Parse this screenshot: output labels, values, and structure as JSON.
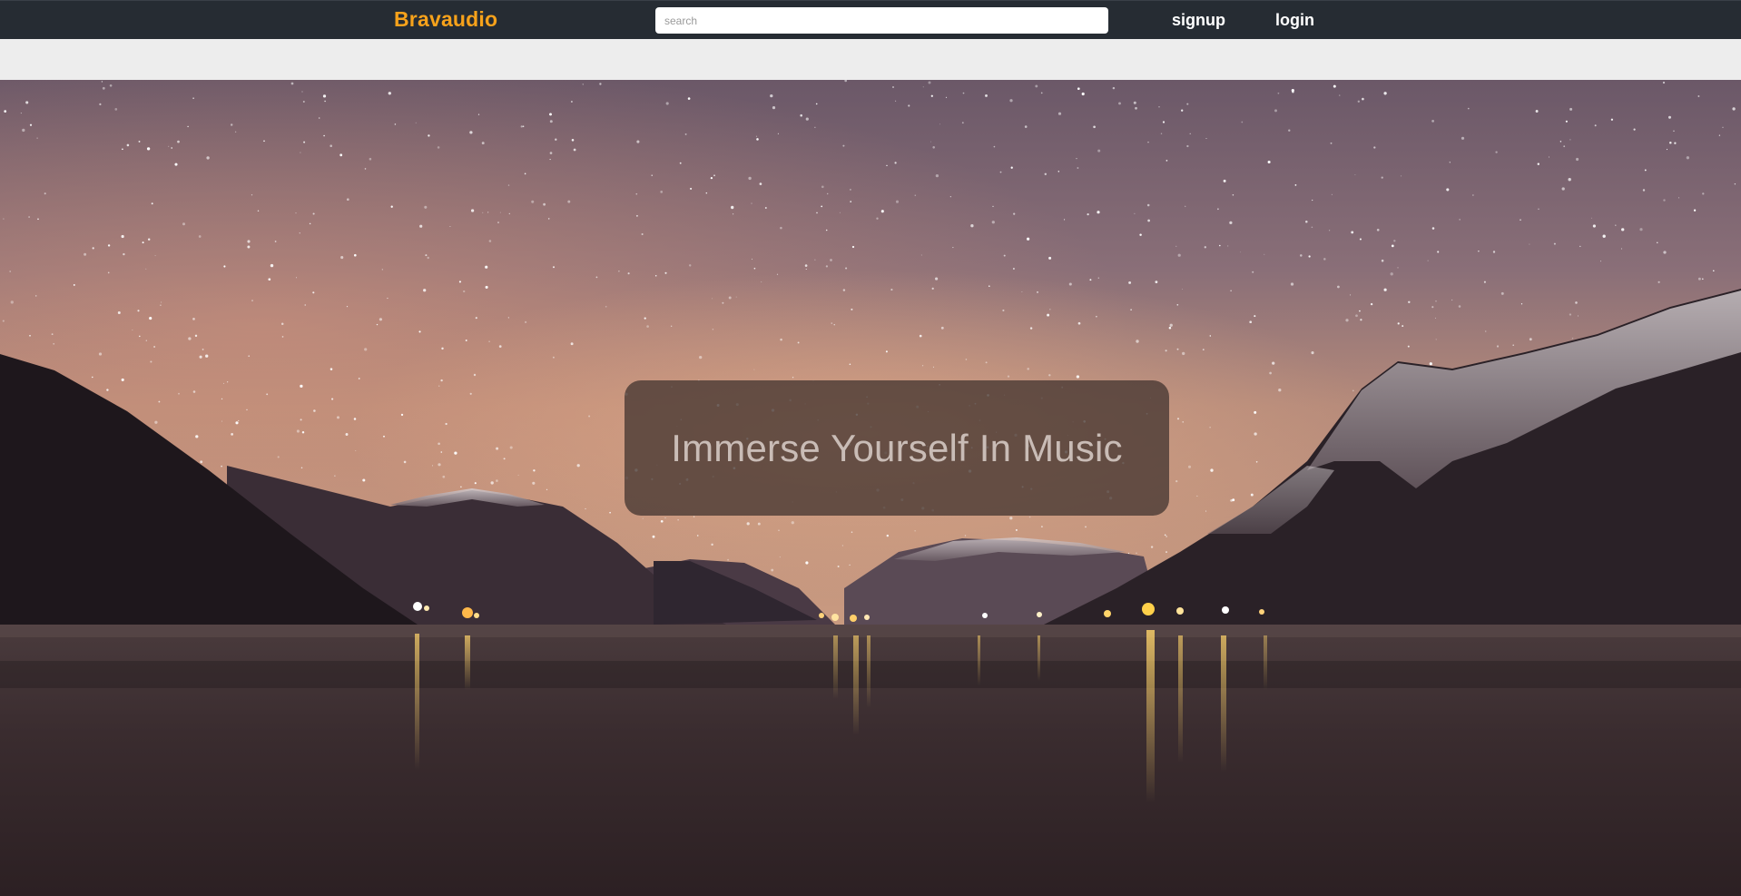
{
  "app": {
    "brand": "Bravaudio",
    "brand_color": "#f7a21b"
  },
  "nav": {
    "search_placeholder": "search",
    "signup_label": "signup",
    "login_label": "login"
  },
  "hero": {
    "tagline": "Immerse Yourself In Music",
    "background": "night sky over fjord with mountains and lights reflecting on water"
  }
}
